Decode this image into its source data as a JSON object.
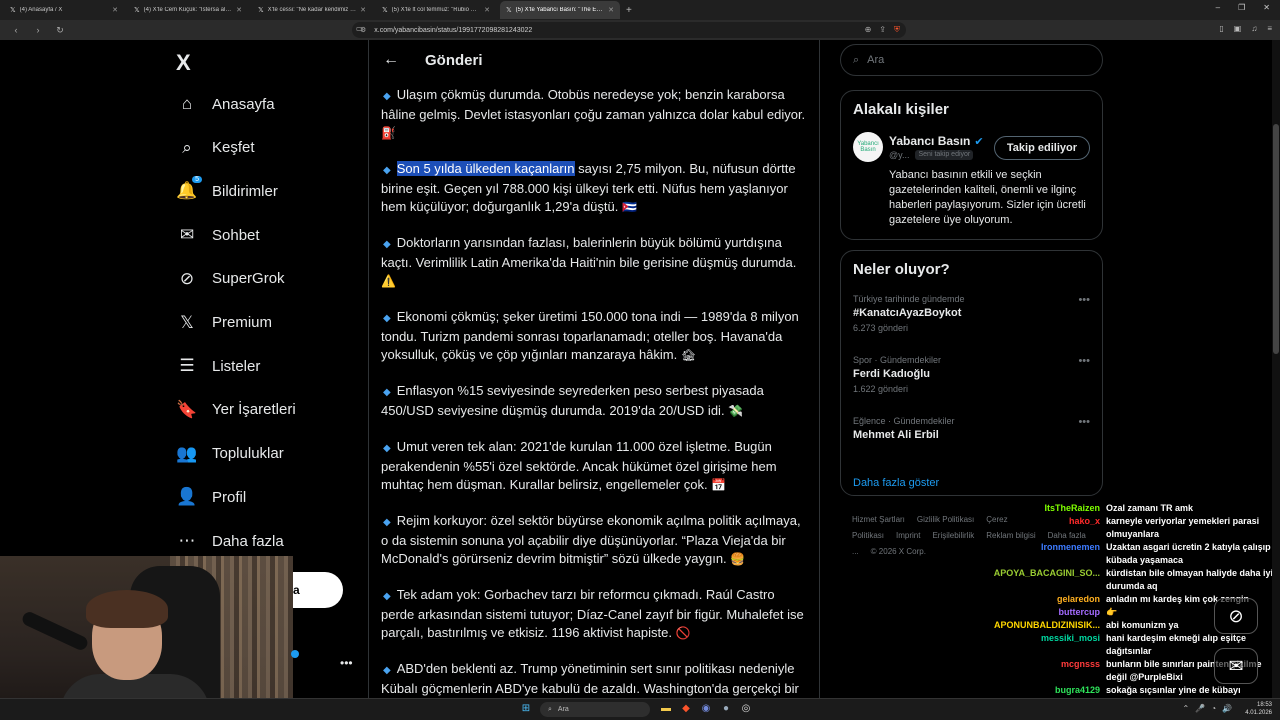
{
  "browser": {
    "tabs": [
      {
        "label": "(4) Anasayfa / X",
        "active": false
      },
      {
        "label": "(4) X'te Cem Küçük: \"İstersa alır. İran\"",
        "active": false
      },
      {
        "label": "X'te cessi: \"Ne kadar kendimiz alegt\"",
        "active": false
      },
      {
        "label": "(5) X'te lt col temmuz: \"Rubio Küba\"",
        "active": false
      },
      {
        "label": "(5) X'te Yabancı Basın: \"The Econ\"",
        "active": true
      }
    ],
    "new_tab": "+",
    "url": "x.com/yabancibasin/status/1991772098281243022"
  },
  "sidebar": {
    "logo": "X",
    "items": [
      {
        "label": "Anasayfa",
        "icon": "home-icon",
        "glyph": "⌂"
      },
      {
        "label": "Keşfet",
        "icon": "search-icon",
        "glyph": "⌕"
      },
      {
        "label": "Bildirimler",
        "icon": "bell-icon",
        "glyph": "🔔",
        "badge": "5"
      },
      {
        "label": "Sohbet",
        "icon": "mail-icon",
        "glyph": "✉"
      },
      {
        "label": "SuperGrok",
        "icon": "grok-icon",
        "glyph": "⊘"
      },
      {
        "label": "Premium",
        "icon": "x-icon",
        "glyph": "𝕏"
      },
      {
        "label": "Listeler",
        "icon": "list-icon",
        "glyph": "☰"
      },
      {
        "label": "Yer İşaretleri",
        "icon": "bookmark-icon",
        "glyph": "🔖"
      },
      {
        "label": "Topluluklar",
        "icon": "people-icon",
        "glyph": "👥"
      },
      {
        "label": "Profil",
        "icon": "profile-icon",
        "glyph": "👤"
      },
      {
        "label": "Daha fazla",
        "icon": "more-icon",
        "glyph": "⋯"
      }
    ],
    "post_button": "a"
  },
  "main": {
    "header_title": "Gönderi",
    "paragraphs": [
      {
        "text": "Ulaşım çökmüş durumda. Otobüs neredeyse yok; benzin karaborsa hâline gelmiş. Devlet istasyonları çoğu zaman yalnızca dolar kabul ediyor.",
        "emoji": "⛽"
      },
      {
        "highlight": "Son 5 yılda ülkeden kaçanların",
        "text": " sayısı 2,75 milyon. Bu, nüfusun dörtte birine eşit. Geçen yıl 788.000 kişi ülkeyi terk etti. Nüfus hem yaşlanıyor hem küçülüyor; doğurganlık 1,29'a düştü.",
        "emoji": "🇨🇺"
      },
      {
        "text": "Doktorların yarısından fazlası, balerinlerin büyük bölümü yurtdışına kaçtı. Verimlilik Latin Amerika'da Haiti'nin bile gerisine düşmüş durumda.",
        "emoji": "⚠️"
      },
      {
        "text": "Ekonomi çökmüş; şeker üretimi 150.000 tona indi — 1989'da 8 milyon tondu. Turizm pandemi sonrası toparlanamadı; oteller boş. Havana'da yoksulluk, çöküş ve çöp yığınları manzaraya hâkim.",
        "emoji": "🏚"
      },
      {
        "text": "Enflasyon %15 seviyesinde seyrederken peso serbest piyasada 450/USD seviyesine düşmüş durumda. 2019'da 20/USD idi.",
        "emoji": "💸"
      },
      {
        "text": "Umut veren tek alan: 2021'de kurulan 11.000 özel işletme. Bugün perakendenin %55'i özel sektörde. Ancak hükümet özel girişime hem muhtaç hem düşman. Kurallar belirsiz, engellemeler çok.",
        "emoji": "📅"
      },
      {
        "text": "Rejim korkuyor: özel sektör büyürse ekonomik açılma politik açılmaya, o da sistemin sonuna yol açabilir diye düşünüyorlar. “Plaza Vieja'da bir McDonald's görürseniz devrim bitmiştir” sözü ülkede yaygın.",
        "emoji": "🍔"
      },
      {
        "text": "Tek adam yok: Gorbachev tarzı bir reformcu çıkmadı. Raúl Castro perde arkasından sistemi tutuyor; Díaz-Canel zayıf bir figür. Muhalefet ise parçalı, bastırılmış ve etkisiz. 1196 aktivist hapiste.",
        "emoji": "🚫"
      },
      {
        "text": "ABD'den beklenti az. Trump yönetiminin sert sınır politikası nedeniyle Kübalı göçmenlerin ABD'ye kabulü de azaldı. Washington'da gerçekçi bir",
        "emoji": ""
      }
    ]
  },
  "right": {
    "search_placeholder": "Ara",
    "related": {
      "title": "Alakalı kişiler",
      "name": "Yabancı Basın",
      "handle": "@y...",
      "follows_you": "Seni takip ediyor",
      "follow_button": "Takip ediliyor",
      "bio": "Yabancı basının etkili ve seçkin gazetelerinden kaliteli, önemli ve ilginç haberleri paylaşıyorum. Sizler için ücretli gazetelere üye oluyorum."
    },
    "trends": {
      "title": "Neler oluyor?",
      "items": [
        {
          "category": "Türkiye tarihinde gündemde",
          "name": "#KanatcıAyazBoykot",
          "count": "6.273 gönderi"
        },
        {
          "category": "Spor · Gündemdekiler",
          "name": "Ferdi Kadıoğlu",
          "count": "1.622 gönderi"
        },
        {
          "category": "Eğlence · Gündemdekiler",
          "name": "Mehmet Ali Erbil",
          "count": ""
        }
      ],
      "show_more": "Daha fazla göster"
    },
    "footer": [
      "Hizmet Şartları",
      "Gizlilik Politikası",
      "Çerez Politikası",
      "Imprint",
      "Erişilebilirlik",
      "Reklam bilgisi",
      "Daha fazla ...",
      "© 2026 X Corp."
    ]
  },
  "chat": [
    {
      "user": "ItsTheRaizen",
      "color": "#7fff00",
      "msg": "Ozal zamanı TR amk"
    },
    {
      "user": "hako_x",
      "color": "#ff2a2a",
      "msg": "karneyle veriyorlar yemekleri parasi olmuyanlara"
    },
    {
      "user": "Ironmenemen",
      "color": "#3d7bff",
      "msg": "Uzaktan asgari ücretin 2 katıyla çalışıp kübada yaşamaca"
    },
    {
      "user": "APOYA_BACAGINI_SO...",
      "color": "#9acd32",
      "msg": "kürdistan bile olmayan haliyde daha iyi durumda aq"
    },
    {
      "user": "gelaredon",
      "color": "#ffb020",
      "msg": "anladın mı kardeş kim çok zengin"
    },
    {
      "user": "buttercup",
      "color": "#a46bff",
      "msg": "👉"
    },
    {
      "user": "APONUNBALDIZINISIK...",
      "color": "#ffd700",
      "msg": "abi komunizm ya"
    },
    {
      "user": "messiki_mosi",
      "color": "#00d7a0",
      "msg": "hani kardeşim ekmeği alıp eşitçe dağıtsınlar"
    },
    {
      "user": "mcgnsss",
      "color": "#ff3b3b",
      "msg": "bunların bile sınırları painten çizilme değil @PurpleBixi"
    },
    {
      "user": "bugra4129",
      "color": "#2ee35a",
      "msg": "sokağa sıçsınlar yine de kübayı yedirmesinler :d"
    }
  ],
  "taskbar": {
    "search": "Ara",
    "time": "18:53",
    "date": "4.01.2026"
  }
}
